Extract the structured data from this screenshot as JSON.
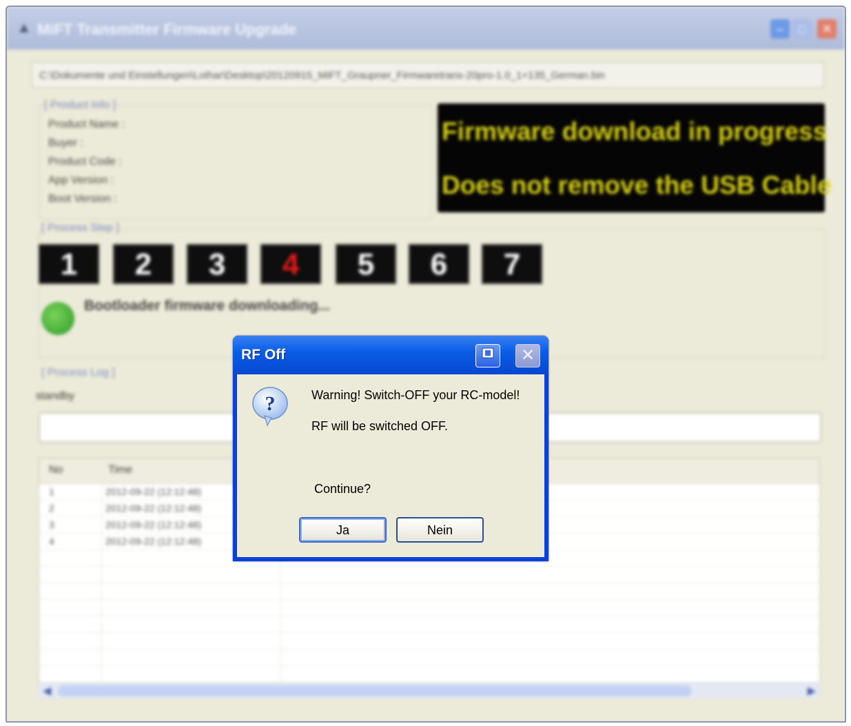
{
  "main_window": {
    "title": "MiFT Transmitter Firmware Upgrade",
    "file_path": "C:\\Dokumente und Einstellungen\\Lothar\\Desktop\\20120915_MiFT_Graupner_Firmwaretrans-20pro-1.0_1+135_German.bin",
    "product_info": {
      "group_title": "[ Product Info ]",
      "labels": [
        "Product Name :",
        "Buyer :",
        "Product Code :",
        "App Version :",
        "Boot Version :"
      ]
    },
    "banner": {
      "line1": "Firmware download in progress",
      "line2": "Does not remove the USB Cable",
      "text_color": "#d6cf18",
      "background": "#050505"
    },
    "process_step": {
      "group_title": "[ Process Step ]",
      "steps": [
        "1",
        "2",
        "3",
        "4",
        "5",
        "6",
        "7"
      ],
      "active_step": "4",
      "active_color": "#e01a1a"
    },
    "status_text": "Bootloader firmware downloading...",
    "process_log": {
      "group_title": "[ Process Log ]",
      "state": "standby",
      "columns": [
        "No",
        "Time"
      ],
      "rows": [
        {
          "no": "1",
          "time": "2012-09-22 (12:12:48)"
        },
        {
          "no": "2",
          "time": "2012-09-22 (12:12:48)"
        },
        {
          "no": "3",
          "time": "2012-09-22 (12:12:48)"
        },
        {
          "no": "4",
          "time": "2012-09-22 (12:12:48)"
        }
      ]
    }
  },
  "dialog": {
    "title": "RF Off",
    "message_1": "Warning! Switch-OFF your RC-model!",
    "message_2": "RF will be switched OFF.",
    "question": "Continue?",
    "yes_label": "Ja",
    "no_label": "Nein",
    "icon": "question-icon",
    "accent_color": "#0a41d8"
  }
}
